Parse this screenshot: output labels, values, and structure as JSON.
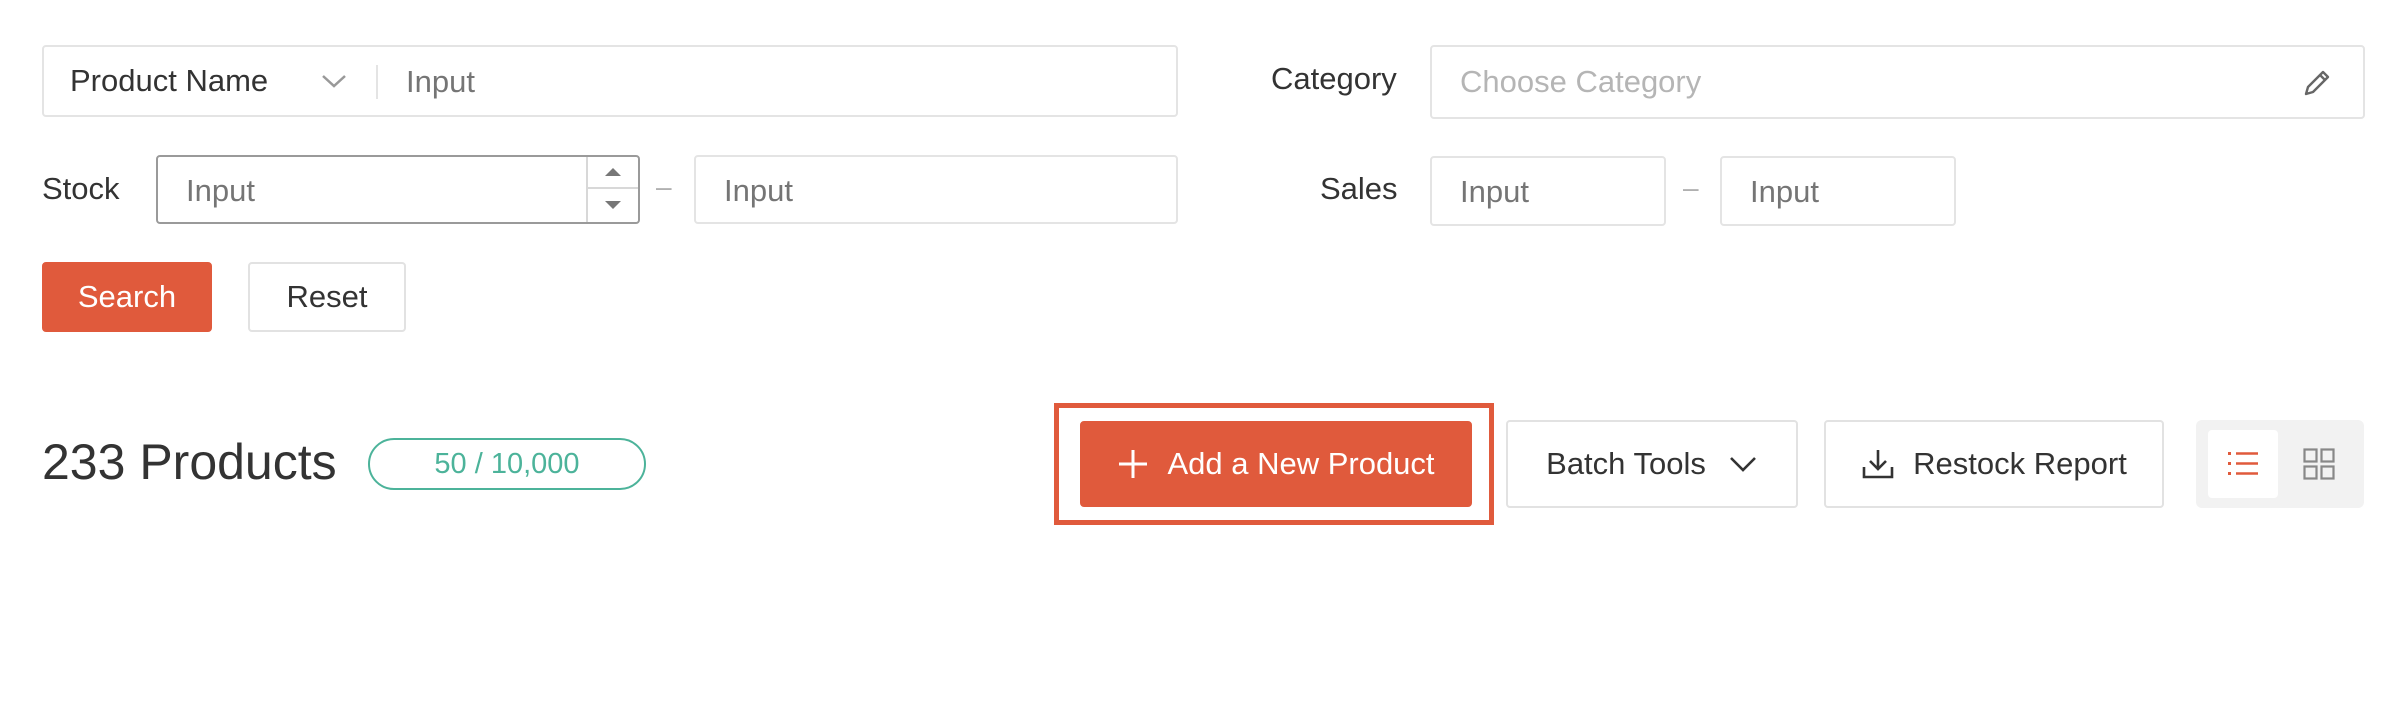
{
  "filters": {
    "product_name_select": "Product Name",
    "product_name_placeholder": "Input",
    "category_label": "Category",
    "category_placeholder": "Choose Category",
    "stock_label": "Stock",
    "stock_min_placeholder": "Input",
    "stock_max_placeholder": "Input",
    "range_separator": "–",
    "sales_label": "Sales",
    "sales_min_placeholder": "Input",
    "sales_max_placeholder": "Input",
    "search_label": "Search",
    "reset_label": "Reset"
  },
  "toolbar": {
    "products_count_title": "233 Products",
    "quota_badge": "50 / 10,000",
    "add_product_label": "Add a New Product",
    "batch_tools_label": "Batch Tools",
    "restock_report_label": "Restock Report",
    "view_modes": [
      "list-view",
      "grid-view"
    ],
    "active_view": "list-view"
  },
  "colors": {
    "primary": "#e05a3c",
    "badge_green": "#4cb39a",
    "border": "#e4e4e4",
    "placeholder": "#b5b5b5"
  },
  "icons": [
    "chevron-down-icon",
    "edit-pencil-icon",
    "caret-up-icon",
    "caret-down-icon",
    "plus-icon",
    "download-icon",
    "list-icon",
    "grid-icon"
  ]
}
